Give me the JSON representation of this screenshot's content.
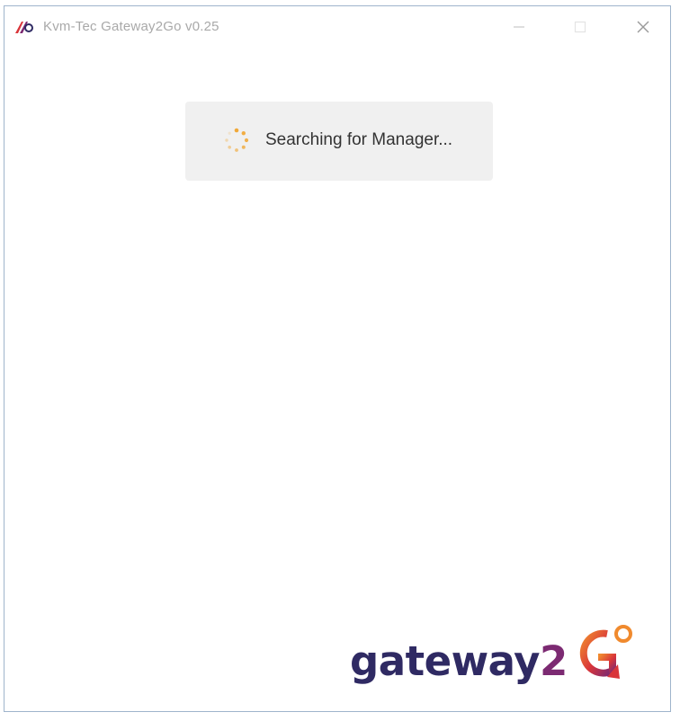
{
  "window": {
    "title": "Kvm-Tec Gateway2Go v0.25",
    "controls": {
      "minimize_icon": "minimize-icon",
      "maximize_icon": "maximize-icon",
      "close_icon": "close-icon"
    }
  },
  "status": {
    "message": "Searching for Manager...",
    "spinner_color": "#f0a93a"
  },
  "logo": {
    "word": "gateway",
    "two": "2",
    "colors": {
      "word": "#2f2a63",
      "accent_orange": "#f08a2e",
      "accent_red": "#d9353a",
      "accent_purple": "#7c2a72"
    }
  }
}
